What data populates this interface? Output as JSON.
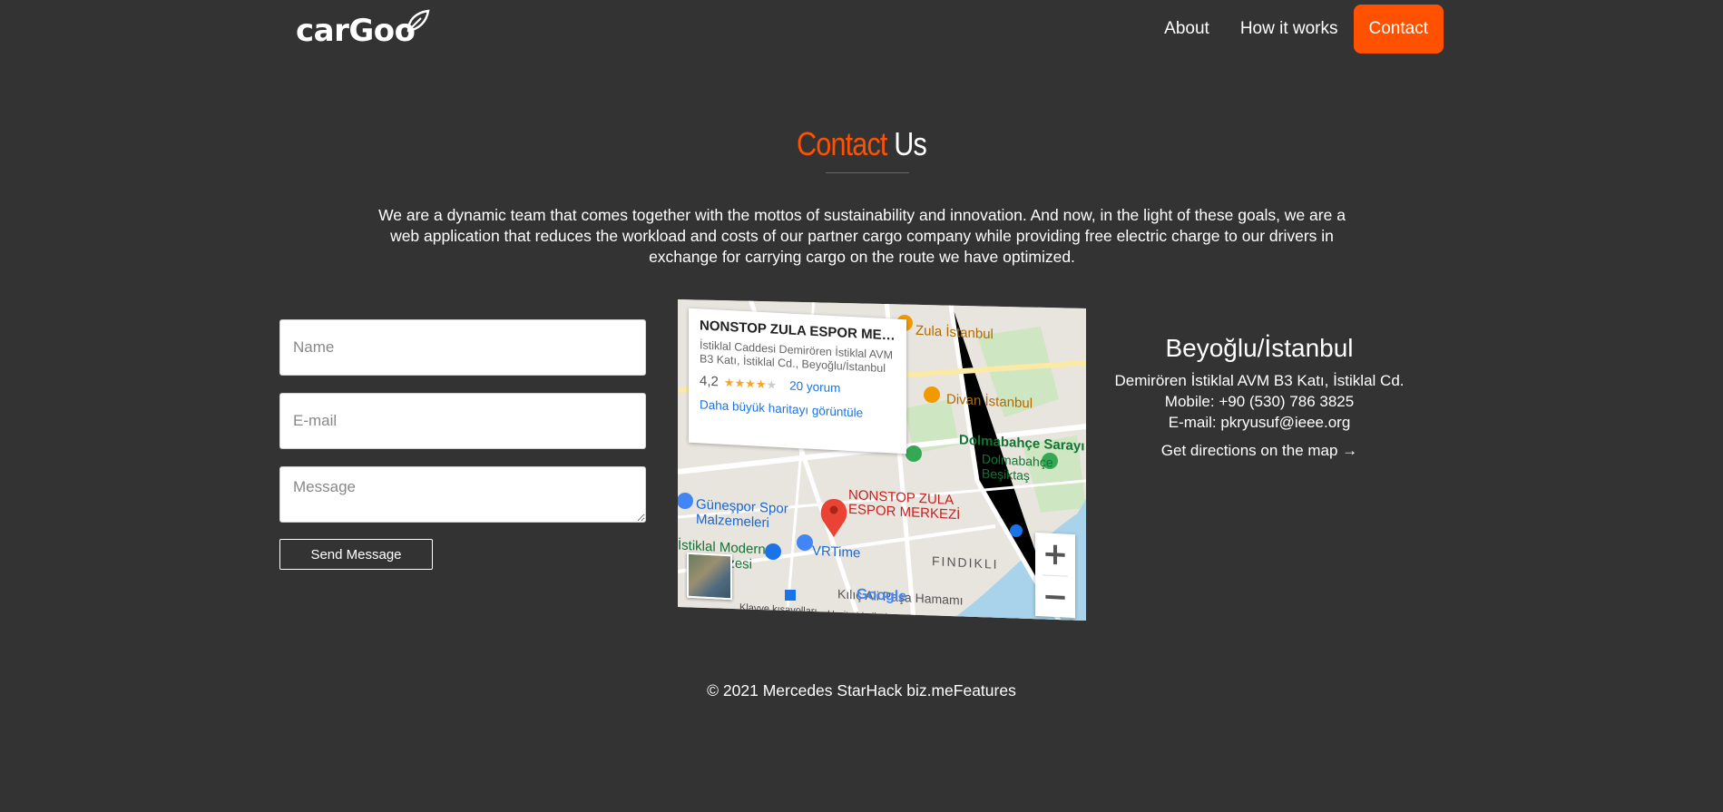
{
  "nav": {
    "logo": "carGoo",
    "links": [
      {
        "label": "About"
      },
      {
        "label": "How it works"
      },
      {
        "label": "Contact"
      }
    ]
  },
  "hero": {
    "title_accent": "Contact",
    "title_rest": "Us",
    "description": "We are a dynamic team that comes together with the mottos of sustainability and innovation. And now, in the light of these goals, we are a web application that reduces the workload and costs of our partner cargo company while providing free electric charge to our drivers in exchange for carrying cargo on the route we have optimized."
  },
  "form": {
    "name_placeholder": "Name",
    "email_placeholder": "E-mail",
    "message_placeholder": "Message",
    "send_label": "Send Message"
  },
  "map": {
    "place_name": "NONSTOP ZULA ESPOR MER...",
    "address": "İstiklal Caddesi Demirören İstiklal AVM B3 Katı, İstiklal Cd., Beyoğlu/İstanbul",
    "rating": "4,2",
    "reviews": "20 yorum",
    "bigger_map": "Daha büyük haritayı görüntüle",
    "labels": {
      "zula": "Zula İstanbul",
      "divan": "Divan İstanbul",
      "dolmabahce_sarayi": "Dolmabahçe Sarayı",
      "dolmabahce_besiktas": "Dolmabahçe Beşiktaş",
      "pin_label_1": "NONSTOP ZULA",
      "pin_label_2": "ESPOR MERKEZİ",
      "gunespor_1": "Güneşpor Spor",
      "gunespor_2": "Malzemeleri",
      "vrtime": "VRTime",
      "findikli": "FINDIKLI",
      "istiklal_modern_1": "İstiklal Modern",
      "istiklal_modern_2": "izesi",
      "kilic": "Kılıç Ali Paşa Hamamı",
      "shortcuts": "Klavye kısayolları",
      "map_data": "Harita Verileri",
      "google": "Google"
    },
    "zoom_in": "+",
    "zoom_out": "−"
  },
  "contact": {
    "city": "Beyoğlu/İstanbul",
    "address": "Demirören İstiklal AVM B3 Katı, İstiklal Cd.",
    "mobile": "Mobile: +90 (530) 786 3825",
    "email": "E-mail: pkryusuf@ieee.org",
    "directions": "Get directions on the map →"
  },
  "footer": {
    "copyright": "© 2021 Mercedes StarHack biz.meFeatures"
  },
  "colors": {
    "accent": "#ff5100",
    "background": "#333333"
  }
}
